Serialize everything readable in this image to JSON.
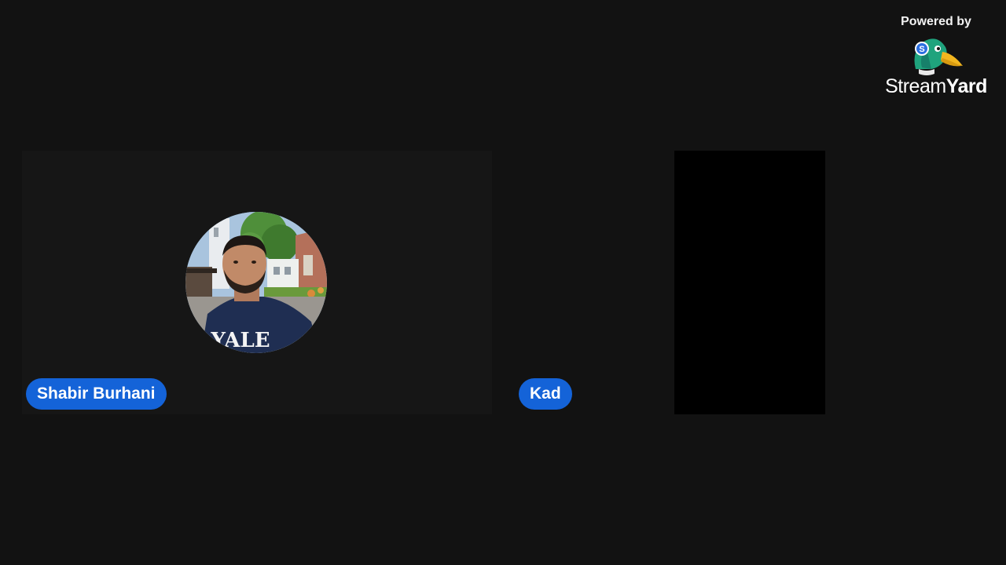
{
  "participants": [
    {
      "name": "Shabir Burhani",
      "has_avatar": true,
      "video": "off"
    },
    {
      "name": "Kad",
      "has_avatar": false,
      "video": "black"
    }
  ],
  "branding": {
    "powered_by": "Powered by",
    "wordmark_light": "Stream",
    "wordmark_bold": "Yard",
    "logo_icon": "duck-icon",
    "logo_badge": "S"
  },
  "colors": {
    "background": "#121212",
    "name_tag": "#1463d8",
    "duck_head": "#1fa37d",
    "duck_beak": "#f2b61f"
  }
}
